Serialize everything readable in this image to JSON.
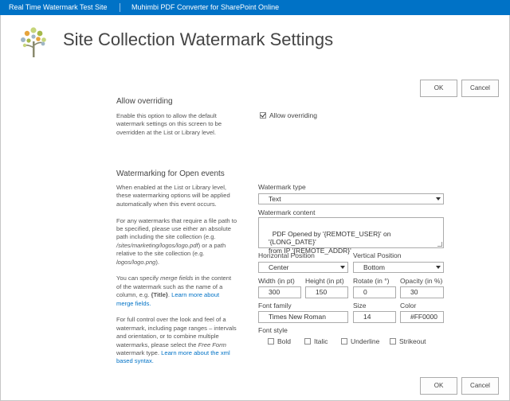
{
  "suitebar": {
    "site_name": "Real Time Watermark Test Site",
    "app_name": "Muhimbi PDF Converter for SharePoint Online"
  },
  "logo": {
    "icon": "tree-logo-icon"
  },
  "page": {
    "title": "Site Collection Watermark Settings"
  },
  "buttons": {
    "ok": "OK",
    "cancel": "Cancel"
  },
  "sections": {
    "overriding": {
      "title": "Allow overriding",
      "description": "Enable this option to allow the default watermark settings on this screen to be overridden at the List or Library level.",
      "checkbox_label": "Allow overriding",
      "checked": true
    },
    "open_events": {
      "title": "Watermarking for Open events",
      "desc1": "When enabled at the List or Library level, these watermarking options will be applied automatically when this event occurs.",
      "desc2_a": "For any watermarks that require a file path to be specified, please use either an absolute path including the site collection (e.g. ",
      "desc2_path1": "/sites/marketing/logos/logo.pdf",
      "desc2_b": ") or a path relative to the site collection (e.g. ",
      "desc2_path2": "logos/logo.png",
      "desc2_c": ").",
      "desc3_a": "You can specify ",
      "desc3_em": "merge fields",
      "desc3_b": " in the content of the watermark such as the name of a column, e.g. ",
      "desc3_title": "{Title}",
      "desc3_c": ". ",
      "desc3_link": "Learn more about merge fields.",
      "desc4_a": "For full control over the look and feel of a watermark, including page ranges – intervals and orientation, or to combine multiple watermarks, please select the ",
      "desc4_em": "Free Form",
      "desc4_b": " watermark type. ",
      "desc4_link": "Learn more about the xml based syntax."
    }
  },
  "form": {
    "watermark_type": {
      "label": "Watermark type",
      "value": "Text"
    },
    "watermark_content": {
      "label": "Watermark content",
      "value": "PDF Opened by '{REMOTE_USER}' on '{LONG_DATE}'\nfrom IP '{REMOTE_ADDR}'"
    },
    "horizontal_position": {
      "label": "Horizontal Position",
      "value": "Center"
    },
    "vertical_position": {
      "label": "Vertical Position",
      "value": "Bottom"
    },
    "width": {
      "label": "Width (in pt)",
      "value": "300"
    },
    "height": {
      "label": "Height (in pt)",
      "value": "150"
    },
    "rotate": {
      "label": "Rotate (in °)",
      "value": "0"
    },
    "opacity": {
      "label": "Opacity (in %)",
      "value": "30"
    },
    "font_family": {
      "label": "Font family",
      "value": "Times New Roman"
    },
    "size": {
      "label": "Size",
      "value": "14"
    },
    "color": {
      "label": "Color",
      "value": "#FF0000"
    },
    "font_style": {
      "label": "Font style",
      "bold": "Bold",
      "italic": "Italic",
      "underline": "Underline",
      "strikeout": "Strikeout"
    }
  },
  "colors": {
    "suitebar": "#0072c6",
    "link": "#0072c6"
  }
}
